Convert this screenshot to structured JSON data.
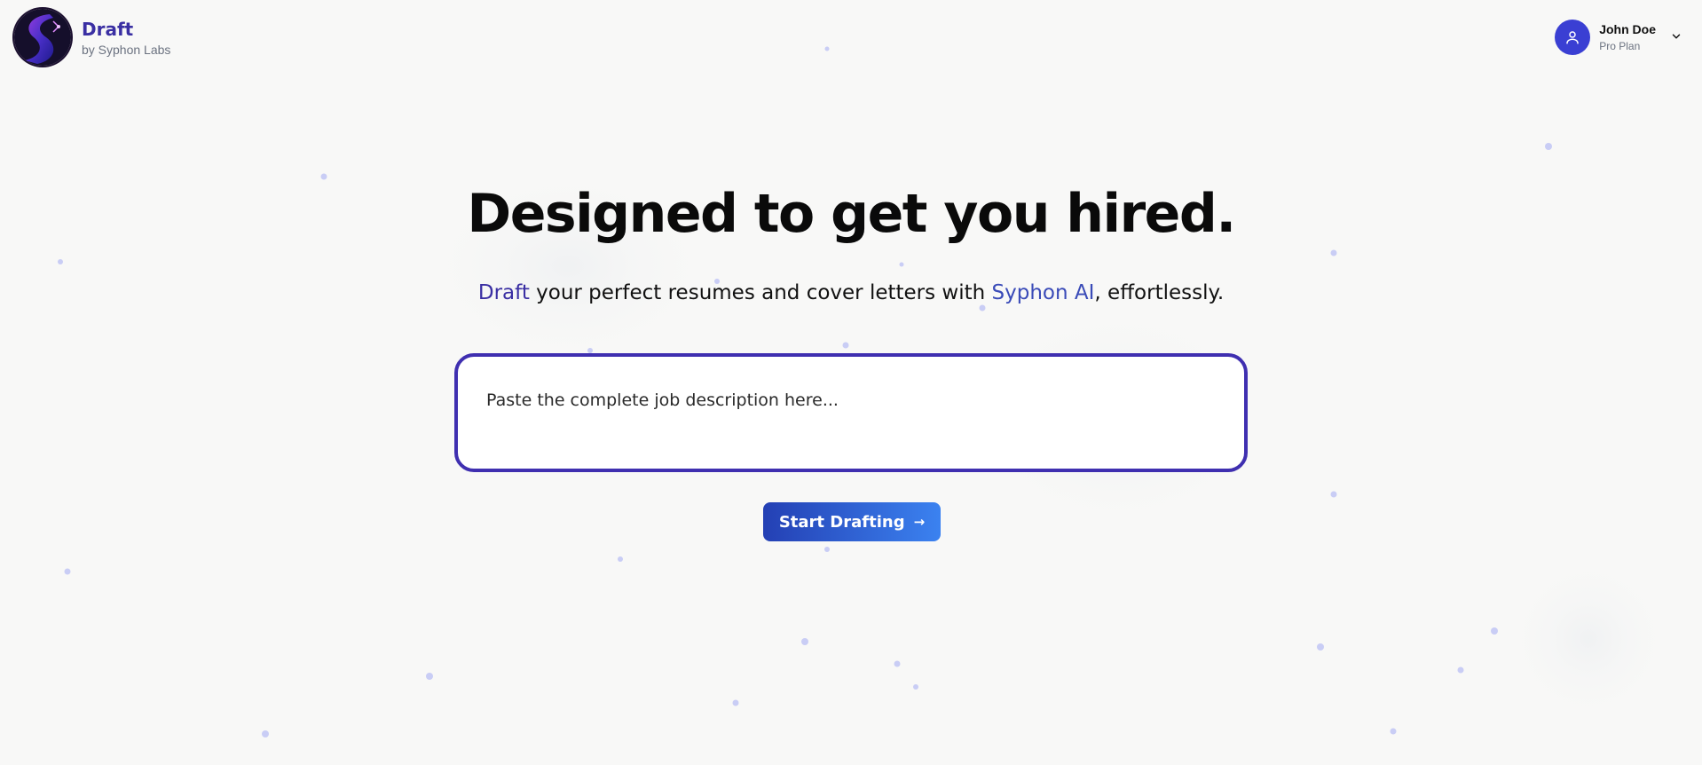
{
  "brand": {
    "name": "Draft",
    "subtitle": "by Syphon Labs",
    "logo_icon": "syphon-logo-icon"
  },
  "user": {
    "name": "John Doe",
    "plan": "Pro Plan",
    "avatar_icon": "user-icon",
    "menu_icon": "chevron-down-icon"
  },
  "hero": {
    "title": "Designed to get you hired.",
    "subtitle_prefix": "Draft",
    "subtitle_middle": " your perfect resumes and cover letters with ",
    "subtitle_brand": "Syphon AI",
    "subtitle_suffix": ", effortlessly."
  },
  "job_input": {
    "placeholder": "Paste the complete job description here...",
    "value": ""
  },
  "cta": {
    "label": "Start Drafting",
    "icon": "arrow-right-icon"
  },
  "colors": {
    "primary": "#3a2fa3",
    "accent": "#3a4bb8",
    "button_start": "#2440b4",
    "button_end": "#3b82f0",
    "background": "#f8f8f7"
  }
}
